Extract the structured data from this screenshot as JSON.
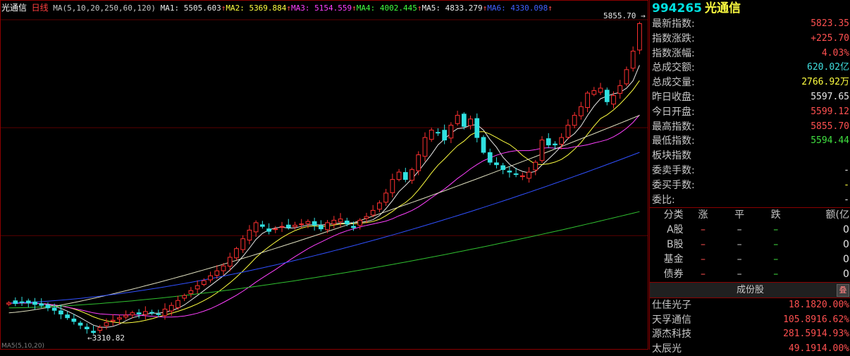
{
  "chart": {
    "stock_name": "光通信",
    "period": "日线",
    "ma_param": "MA(5,10,20,250,60,120)",
    "ma_items": [
      {
        "label": "MA1: 5505.603",
        "arrow": "↑",
        "color": "#e8e8e8"
      },
      {
        "label": "MA2: 5369.884",
        "arrow": "↑",
        "color": "#ffff40"
      },
      {
        "label": "MA3: 5154.559",
        "arrow": "↑",
        "color": "#ff40ff"
      },
      {
        "label": "MA4: 4002.445",
        "arrow": "↑",
        "color": "#40ff40"
      },
      {
        "label": "MA5: 4833.279",
        "arrow": "↑",
        "color": "#e8e8e8"
      },
      {
        "label": "MA6: 4330.098",
        "arrow": "↑",
        "color": "#4060ff"
      }
    ],
    "high_label": "5855.70",
    "low_label": "3310.82",
    "up_color": "#ff3030",
    "down_color": "#30e0e0"
  },
  "chart_data": {
    "type": "candlestick",
    "high": 5855.7,
    "low": 3310.82,
    "closes": [
      3560,
      3555,
      3565,
      3560,
      3548,
      3540,
      3520,
      3500,
      3470,
      3440,
      3410,
      3380,
      3350,
      3320,
      3360,
      3400,
      3420,
      3440,
      3460,
      3480,
      3470,
      3490,
      3480,
      3470,
      3510,
      3540,
      3580,
      3620,
      3660,
      3700,
      3740,
      3780,
      3820,
      3860,
      3930,
      4000,
      4080,
      4150,
      4210,
      4180,
      4140,
      4160,
      4180,
      4170,
      4190,
      4200,
      4220,
      4190,
      4160,
      4210,
      4230,
      4240,
      4200,
      4170,
      4230,
      4260,
      4310,
      4370,
      4450,
      4560,
      4620,
      4560,
      4640,
      4760,
      4900,
      4960,
      4940,
      4880,
      5000,
      5080,
      4990,
      5050,
      4900,
      4780,
      4700,
      4680,
      4640,
      4620,
      4600,
      4590,
      4620,
      4700,
      4880,
      4840,
      4840,
      4900,
      5000,
      5080,
      5150,
      5260,
      5280,
      5300,
      5190,
      5240,
      5320,
      5450,
      5600,
      5823
    ],
    "ma_series": [
      {
        "name": "MA1",
        "color": "#e8e8e8",
        "value": 5505.603
      },
      {
        "name": "MA2",
        "color": "#ffff40",
        "value": 5369.884
      },
      {
        "name": "MA3",
        "color": "#ff40ff",
        "value": 5154.559
      },
      {
        "name": "MA4",
        "color": "#40ff40",
        "value": 4002.445
      },
      {
        "name": "MA5",
        "color": "#e8e8e8",
        "value": 4833.279
      },
      {
        "name": "MA6",
        "color": "#4060ff",
        "value": 4330.098
      }
    ]
  },
  "side": {
    "code": "994265",
    "name": "光通信",
    "rows": [
      {
        "label": "最新指数:",
        "value": "5823.35",
        "cls": "red"
      },
      {
        "label": "指数涨跌:",
        "value": "+225.70",
        "cls": "red"
      },
      {
        "label": "指数涨幅:",
        "value": "4.03%",
        "cls": "red"
      },
      {
        "label": "总成交额:",
        "value": "620.02亿",
        "cls": "cyan"
      },
      {
        "label": "总成交量:",
        "value": "2766.92万",
        "cls": "yellow"
      },
      {
        "label": "昨日收盘:",
        "value": "5597.65",
        "cls": "white"
      },
      {
        "label": "今日开盘:",
        "value": "5599.12",
        "cls": "red"
      },
      {
        "label": "最高指数:",
        "value": "5855.70",
        "cls": "red"
      },
      {
        "label": "最低指数:",
        "value": "5594.44",
        "cls": "green"
      },
      {
        "label": "板块指数",
        "value": "",
        "cls": "white"
      },
      {
        "label": "委卖手数:",
        "value": "-",
        "cls": "white"
      },
      {
        "label": "委买手数:",
        "value": "-",
        "cls": "yellow"
      },
      {
        "label": "  委比:",
        "value": "-",
        "cls": "white"
      }
    ],
    "cat_headers": [
      "分类",
      "涨",
      "平",
      "跌",
      "额(亿"
    ],
    "cat_rows": [
      {
        "name": "A股",
        "up": "–",
        "flat": "–",
        "down": "–",
        "amt": "0"
      },
      {
        "name": "B股",
        "up": "–",
        "flat": "–",
        "down": "–",
        "amt": "0"
      },
      {
        "name": "基金",
        "up": "–",
        "flat": "–",
        "down": "–",
        "amt": "0"
      },
      {
        "name": "债券",
        "up": "–",
        "flat": "–",
        "down": "–",
        "amt": "0"
      }
    ],
    "comp_header": "成份股",
    "comp_collapse": "叠",
    "components": [
      {
        "name": "仕佳光子",
        "pct": "18.1820.00%"
      },
      {
        "name": "天孚通信",
        "pct": "105.8916.62%"
      },
      {
        "name": "源杰科技",
        "pct": "281.5914.93%"
      },
      {
        "name": "太辰光",
        "pct": "49.1914.00%"
      }
    ]
  },
  "bottom_left": "MA5(5,10,20)"
}
